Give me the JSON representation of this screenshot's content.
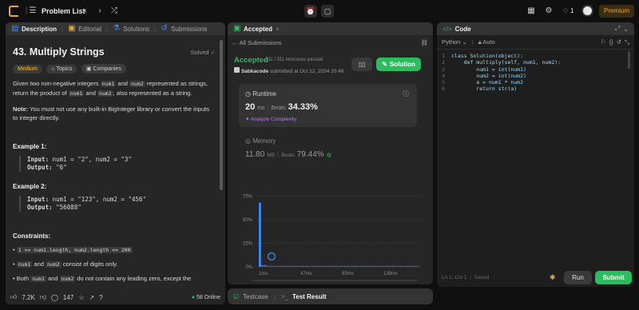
{
  "topbar": {
    "problem_list": "Problem List",
    "streak": "1",
    "premium": "Premium"
  },
  "left": {
    "tabs": [
      "Description",
      "Editorial",
      "Solutions",
      "Submissions"
    ],
    "title": "43. Multiply Strings",
    "solved": "Solved",
    "tags": [
      "Medium",
      "Topics",
      "Companies"
    ],
    "desc": {
      "t1": "Given two non-negative integers ",
      "c1": "num1",
      "t2": " and ",
      "c2": "num2",
      "t3": " represented as strings,",
      "t4": "return the product of ",
      "c3": "num1",
      "t5": " and ",
      "c4": "num2",
      "t6": ", also represented as a string.",
      "note_label": "Note:",
      "note": " You must not use any built-in BigInteger library or convert the inputs to integer directly."
    },
    "examples": [
      {
        "title": "Example 1:",
        "input_label": "Input:",
        "input": " num1 = \"2\", num2 = \"3\"",
        "output_label": "Output:",
        "output": " \"6\""
      },
      {
        "title": "Example 2:",
        "input_label": "Input:",
        "input": " num1 = \"123\", num2 = \"456\"",
        "output_label": "Output:",
        "output": " \"56088\""
      }
    ],
    "constraints_title": "Constraints:",
    "constraints": {
      "c1": "1 <= num1.length, num2.length <= 200",
      "c2a": "num1",
      "c2b": " and ",
      "c2c": "num2",
      "c2d": " consist of digits only.",
      "c3a": "Both ",
      "c3b": "num1",
      "c3c": " and ",
      "c3d": "num2",
      "c3e": " do not contain any leading zero, except the"
    },
    "footer": {
      "likes": "7.2K",
      "comments": "147",
      "online": "58 Online"
    }
  },
  "middle": {
    "tab": "Accepted",
    "back": "All Submissions",
    "status": "Accepted",
    "testcases": "311 / 311 testcases passed",
    "user": "Sabkacode",
    "submitted": "submitted at Oct 12, 2024 20:48",
    "solution_btn": "Solution",
    "runtime": {
      "label": "Runtime",
      "value": "20",
      "unit": "ms",
      "beats_label": "Beats",
      "beats": "34.33%",
      "analyze": "Analyze Complexity"
    },
    "memory": {
      "label": "Memory",
      "value": "11.80",
      "unit": "MB",
      "beats_label": "Beats",
      "beats": "79.44%"
    },
    "chart_y": [
      "75%",
      "50%",
      "25%",
      "0%"
    ],
    "chart_x": [
      "1ms",
      "47ms",
      "93ms",
      "139ms"
    ],
    "bottom": {
      "testcase": "Testcase",
      "test_result": "Test Result"
    }
  },
  "chart_data": {
    "type": "bar",
    "ylim": [
      0,
      100
    ],
    "y_ticks": [
      "75%",
      "50%",
      "25%",
      "0%"
    ],
    "x_ticks": [
      "1ms",
      "47ms",
      "93ms",
      "139ms"
    ],
    "values": [
      68,
      2,
      2,
      1,
      1,
      1,
      1,
      1,
      1,
      1,
      1,
      1,
      1,
      1,
      1,
      1,
      1,
      1,
      1,
      1,
      1,
      1,
      1,
      1,
      1,
      1,
      1,
      1,
      1,
      1,
      1,
      1,
      1,
      1,
      1,
      1,
      1,
      1,
      1,
      1,
      1,
      1,
      1,
      1,
      1,
      1,
      1,
      1,
      1,
      1,
      1,
      1,
      1,
      1,
      1,
      1,
      1,
      1,
      1
    ],
    "accent": "#2cbb5d"
  },
  "right": {
    "title": "Code",
    "lang": "Python",
    "auto": "Auto",
    "lines": [
      "class Solution(object):",
      "    def multiply(self, num1, num2):",
      "        num1 = int(num1)",
      "        num2 = int(num2)",
      "        a = num1 * num2",
      "        return str(a)"
    ],
    "status": "Ln 1, Col 1",
    "saved": "Saved",
    "run": "Run",
    "submit": "Submit"
  }
}
